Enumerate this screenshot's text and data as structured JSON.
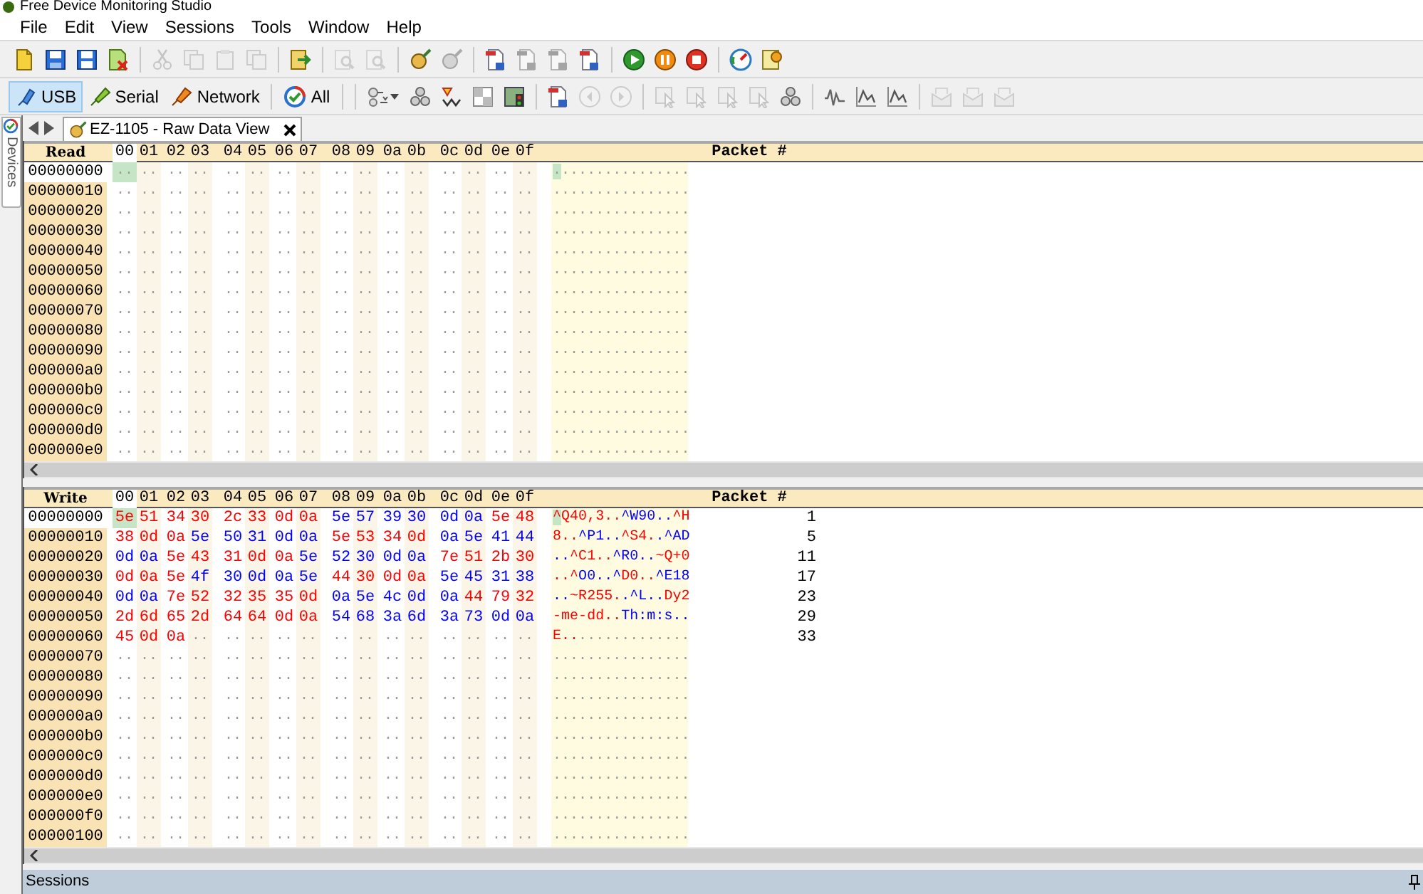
{
  "window": {
    "title": "Free Device Monitoring Studio"
  },
  "menu": [
    "File",
    "Edit",
    "View",
    "Sessions",
    "Tools",
    "Window",
    "Help"
  ],
  "toolbar": [
    {
      "kind": "new",
      "disabled": false
    },
    {
      "kind": "save",
      "disabled": false
    },
    {
      "kind": "saveas",
      "disabled": false
    },
    {
      "kind": "closedoc",
      "disabled": false
    },
    {
      "kind": "sep"
    },
    {
      "kind": "cut",
      "disabled": true
    },
    {
      "kind": "copy",
      "disabled": true
    },
    {
      "kind": "paste",
      "disabled": true
    },
    {
      "kind": "copy",
      "disabled": true
    },
    {
      "kind": "sep"
    },
    {
      "kind": "export",
      "disabled": false
    },
    {
      "kind": "sep"
    },
    {
      "kind": "find",
      "disabled": true
    },
    {
      "kind": "find",
      "disabled": true
    },
    {
      "kind": "sep"
    },
    {
      "kind": "brush",
      "disabled": false
    },
    {
      "kind": "brush",
      "disabled": true
    },
    {
      "kind": "sep"
    },
    {
      "kind": "page",
      "disabled": false
    },
    {
      "kind": "page",
      "disabled": true
    },
    {
      "kind": "page",
      "disabled": true
    },
    {
      "kind": "page",
      "disabled": false
    },
    {
      "kind": "sep"
    },
    {
      "kind": "play",
      "disabled": false
    },
    {
      "kind": "pause",
      "disabled": false
    },
    {
      "kind": "stop",
      "disabled": false
    },
    {
      "kind": "sep"
    },
    {
      "kind": "gauge",
      "disabled": false
    },
    {
      "kind": "gear",
      "disabled": false
    }
  ],
  "filters": [
    {
      "label": "USB",
      "kind": "usb",
      "selected": true
    },
    {
      "label": "Serial",
      "kind": "serial",
      "selected": false
    },
    {
      "label": "Network",
      "kind": "network",
      "selected": false
    },
    {
      "label": "All",
      "kind": "all",
      "selected": false
    }
  ],
  "toolbar2": [
    {
      "kind": "filter",
      "disabled": false
    },
    {
      "kind": "nodes",
      "disabled": false
    },
    {
      "kind": "sort",
      "disabled": false
    },
    {
      "kind": "grid",
      "disabled": false
    },
    {
      "kind": "traffic",
      "disabled": false
    },
    {
      "kind": "sep"
    },
    {
      "kind": "page",
      "disabled": false
    },
    {
      "kind": "prev",
      "disabled": true
    },
    {
      "kind": "next",
      "disabled": true
    },
    {
      "kind": "sep"
    },
    {
      "kind": "cursor",
      "disabled": true
    },
    {
      "kind": "cursor",
      "disabled": true
    },
    {
      "kind": "cursor",
      "disabled": true
    },
    {
      "kind": "cursor",
      "disabled": true
    },
    {
      "kind": "nodes",
      "disabled": false
    },
    {
      "kind": "sep"
    },
    {
      "kind": "wave",
      "disabled": false
    },
    {
      "kind": "chart",
      "disabled": false
    },
    {
      "kind": "chart",
      "disabled": false
    },
    {
      "kind": "sep"
    },
    {
      "kind": "mail",
      "disabled": true
    },
    {
      "kind": "mail",
      "disabled": true
    },
    {
      "kind": "mail",
      "disabled": true
    }
  ],
  "side_panel": {
    "label": "Devices"
  },
  "tab": {
    "label": "EZ-1105 - Raw Data View",
    "selected": true
  },
  "read_pane": {
    "title": "Read",
    "packet_header": "Packet #",
    "columns": [
      {
        "label": "00",
        "selected": true
      },
      {
        "label": "01",
        "selected": false
      },
      {
        "label": "02",
        "selected": false
      },
      {
        "label": "03",
        "selected": false
      },
      {
        "label": "04",
        "selected": false
      },
      {
        "label": "05",
        "selected": false
      },
      {
        "label": "06",
        "selected": false
      },
      {
        "label": "07",
        "selected": false
      },
      {
        "label": "08",
        "selected": false
      },
      {
        "label": "09",
        "selected": false
      },
      {
        "label": "0a",
        "selected": false
      },
      {
        "label": "0b",
        "selected": false
      },
      {
        "label": "0c",
        "selected": false
      },
      {
        "label": "0d",
        "selected": false
      },
      {
        "label": "0e",
        "selected": false
      },
      {
        "label": "0f",
        "selected": false
      }
    ],
    "rows": [
      {
        "address": "00000000",
        "selected": true,
        "bytes": [
          "..",
          "..",
          "..",
          "..",
          "..",
          "..",
          "..",
          "..",
          "..",
          "..",
          "..",
          "..",
          "..",
          "..",
          "..",
          ".."
        ],
        "ascii": "................"
      },
      {
        "address": "00000010",
        "selected": false,
        "bytes": [
          "..",
          "..",
          "..",
          "..",
          "..",
          "..",
          "..",
          "..",
          "..",
          "..",
          "..",
          "..",
          "..",
          "..",
          "..",
          ".."
        ],
        "ascii": "................"
      },
      {
        "address": "00000020",
        "selected": false,
        "bytes": [
          "..",
          "..",
          "..",
          "..",
          "..",
          "..",
          "..",
          "..",
          "..",
          "..",
          "..",
          "..",
          "..",
          "..",
          "..",
          ".."
        ],
        "ascii": "................"
      },
      {
        "address": "00000030",
        "selected": false,
        "bytes": [
          "..",
          "..",
          "..",
          "..",
          "..",
          "..",
          "..",
          "..",
          "..",
          "..",
          "..",
          "..",
          "..",
          "..",
          "..",
          ".."
        ],
        "ascii": "................"
      },
      {
        "address": "00000040",
        "selected": false,
        "bytes": [
          "..",
          "..",
          "..",
          "..",
          "..",
          "..",
          "..",
          "..",
          "..",
          "..",
          "..",
          "..",
          "..",
          "..",
          "..",
          ".."
        ],
        "ascii": "................"
      },
      {
        "address": "00000050",
        "selected": false,
        "bytes": [
          "..",
          "..",
          "..",
          "..",
          "..",
          "..",
          "..",
          "..",
          "..",
          "..",
          "..",
          "..",
          "..",
          "..",
          "..",
          ".."
        ],
        "ascii": "................"
      },
      {
        "address": "00000060",
        "selected": false,
        "bytes": [
          "..",
          "..",
          "..",
          "..",
          "..",
          "..",
          "..",
          "..",
          "..",
          "..",
          "..",
          "..",
          "..",
          "..",
          "..",
          ".."
        ],
        "ascii": "................"
      },
      {
        "address": "00000070",
        "selected": false,
        "bytes": [
          "..",
          "..",
          "..",
          "..",
          "..",
          "..",
          "..",
          "..",
          "..",
          "..",
          "..",
          "..",
          "..",
          "..",
          "..",
          ".."
        ],
        "ascii": "................"
      },
      {
        "address": "00000080",
        "selected": false,
        "bytes": [
          "..",
          "..",
          "..",
          "..",
          "..",
          "..",
          "..",
          "..",
          "..",
          "..",
          "..",
          "..",
          "..",
          "..",
          "..",
          ".."
        ],
        "ascii": "................"
      },
      {
        "address": "00000090",
        "selected": false,
        "bytes": [
          "..",
          "..",
          "..",
          "..",
          "..",
          "..",
          "..",
          "..",
          "..",
          "..",
          "..",
          "..",
          "..",
          "..",
          "..",
          ".."
        ],
        "ascii": "................"
      },
      {
        "address": "000000a0",
        "selected": false,
        "bytes": [
          "..",
          "..",
          "..",
          "..",
          "..",
          "..",
          "..",
          "..",
          "..",
          "..",
          "..",
          "..",
          "..",
          "..",
          "..",
          ".."
        ],
        "ascii": "................"
      },
      {
        "address": "000000b0",
        "selected": false,
        "bytes": [
          "..",
          "..",
          "..",
          "..",
          "..",
          "..",
          "..",
          "..",
          "..",
          "..",
          "..",
          "..",
          "..",
          "..",
          "..",
          ".."
        ],
        "ascii": "................"
      },
      {
        "address": "000000c0",
        "selected": false,
        "bytes": [
          "..",
          "..",
          "..",
          "..",
          "..",
          "..",
          "..",
          "..",
          "..",
          "..",
          "..",
          "..",
          "..",
          "..",
          "..",
          ".."
        ],
        "ascii": "................"
      },
      {
        "address": "000000d0",
        "selected": false,
        "bytes": [
          "..",
          "..",
          "..",
          "..",
          "..",
          "..",
          "..",
          "..",
          "..",
          "..",
          "..",
          "..",
          "..",
          "..",
          "..",
          ".."
        ],
        "ascii": "................"
      },
      {
        "address": "000000e0",
        "selected": false,
        "bytes": [
          "..",
          "..",
          "..",
          "..",
          "..",
          "..",
          "..",
          "..",
          "..",
          "..",
          "..",
          "..",
          "..",
          "..",
          "..",
          ".."
        ],
        "ascii": "................"
      }
    ]
  },
  "write_pane": {
    "title": "Write",
    "packet_header": "Packet #",
    "columns": [
      {
        "label": "00",
        "selected": true
      },
      {
        "label": "01",
        "selected": false
      },
      {
        "label": "02",
        "selected": false
      },
      {
        "label": "03",
        "selected": false
      },
      {
        "label": "04",
        "selected": false
      },
      {
        "label": "05",
        "selected": false
      },
      {
        "label": "06",
        "selected": false
      },
      {
        "label": "07",
        "selected": false
      },
      {
        "label": "08",
        "selected": false
      },
      {
        "label": "09",
        "selected": false
      },
      {
        "label": "0a",
        "selected": false
      },
      {
        "label": "0b",
        "selected": false
      },
      {
        "label": "0c",
        "selected": false
      },
      {
        "label": "0d",
        "selected": false
      },
      {
        "label": "0e",
        "selected": false
      },
      {
        "label": "0f",
        "selected": false
      }
    ],
    "rows": [
      {
        "address": "00000000",
        "selected": true,
        "packet": "1",
        "bytes": [
          {
            "text": "5e",
            "color": "#ff0000"
          },
          {
            "text": "51",
            "color": "#ff0000"
          },
          {
            "text": "34",
            "color": "#ff0000"
          },
          {
            "text": "30",
            "color": "#ff0000"
          },
          {
            "text": "2c",
            "color": "#ff0000"
          },
          {
            "text": "33",
            "color": "#ff0000"
          },
          {
            "text": "0d",
            "color": "#ff0000"
          },
          {
            "text": "0a",
            "color": "#ff0000"
          },
          {
            "text": "5e",
            "color": "#0000ff"
          },
          {
            "text": "57",
            "color": "#0000ff"
          },
          {
            "text": "39",
            "color": "#0000ff"
          },
          {
            "text": "30",
            "color": "#0000ff"
          },
          {
            "text": "0d",
            "color": "#0000ff"
          },
          {
            "text": "0a",
            "color": "#0000ff"
          },
          {
            "text": "5e",
            "color": "#ff0000"
          },
          {
            "text": "48",
            "color": "#ff0000"
          }
        ],
        "ascii": "^Q40,3..^W90..^H"
      },
      {
        "address": "00000010",
        "selected": false,
        "packet": "5",
        "bytes": [
          {
            "text": "38",
            "color": "#ff0000"
          },
          {
            "text": "0d",
            "color": "#ff0000"
          },
          {
            "text": "0a",
            "color": "#ff0000"
          },
          {
            "text": "5e",
            "color": "#0000ff"
          },
          {
            "text": "50",
            "color": "#0000ff"
          },
          {
            "text": "31",
            "color": "#0000ff"
          },
          {
            "text": "0d",
            "color": "#0000ff"
          },
          {
            "text": "0a",
            "color": "#0000ff"
          },
          {
            "text": "5e",
            "color": "#ff0000"
          },
          {
            "text": "53",
            "color": "#ff0000"
          },
          {
            "text": "34",
            "color": "#ff0000"
          },
          {
            "text": "0d",
            "color": "#ff0000"
          },
          {
            "text": "0a",
            "color": "#0000ff"
          },
          {
            "text": "5e",
            "color": "#0000ff"
          },
          {
            "text": "41",
            "color": "#0000ff"
          },
          {
            "text": "44",
            "color": "#0000ff"
          }
        ],
        "ascii": "8..^P1..^S4..^AD"
      },
      {
        "address": "00000020",
        "selected": false,
        "packet": "11",
        "bytes": [
          {
            "text": "0d",
            "color": "#0000ff"
          },
          {
            "text": "0a",
            "color": "#0000ff"
          },
          {
            "text": "5e",
            "color": "#ff0000"
          },
          {
            "text": "43",
            "color": "#ff0000"
          },
          {
            "text": "31",
            "color": "#ff0000"
          },
          {
            "text": "0d",
            "color": "#ff0000"
          },
          {
            "text": "0a",
            "color": "#ff0000"
          },
          {
            "text": "5e",
            "color": "#0000ff"
          },
          {
            "text": "52",
            "color": "#0000ff"
          },
          {
            "text": "30",
            "color": "#0000ff"
          },
          {
            "text": "0d",
            "color": "#0000ff"
          },
          {
            "text": "0a",
            "color": "#0000ff"
          },
          {
            "text": "7e",
            "color": "#ff0000"
          },
          {
            "text": "51",
            "color": "#ff0000"
          },
          {
            "text": "2b",
            "color": "#ff0000"
          },
          {
            "text": "30",
            "color": "#ff0000"
          }
        ],
        "ascii": "..^C1..^R0..~Q+0"
      },
      {
        "address": "00000030",
        "selected": false,
        "packet": "17",
        "bytes": [
          {
            "text": "0d",
            "color": "#ff0000"
          },
          {
            "text": "0a",
            "color": "#ff0000"
          },
          {
            "text": "5e",
            "color": "#ff0000"
          },
          {
            "text": "4f",
            "color": "#0000ff"
          },
          {
            "text": "30",
            "color": "#0000ff"
          },
          {
            "text": "0d",
            "color": "#0000ff"
          },
          {
            "text": "0a",
            "color": "#0000ff"
          },
          {
            "text": "5e",
            "color": "#0000ff"
          },
          {
            "text": "44",
            "color": "#ff0000"
          },
          {
            "text": "30",
            "color": "#ff0000"
          },
          {
            "text": "0d",
            "color": "#ff0000"
          },
          {
            "text": "0a",
            "color": "#ff0000"
          },
          {
            "text": "5e",
            "color": "#0000ff"
          },
          {
            "text": "45",
            "color": "#0000ff"
          },
          {
            "text": "31",
            "color": "#0000ff"
          },
          {
            "text": "38",
            "color": "#0000ff"
          }
        ],
        "ascii": "..^O0..^D0..^E18"
      },
      {
        "address": "00000040",
        "selected": false,
        "packet": "23",
        "bytes": [
          {
            "text": "0d",
            "color": "#0000ff"
          },
          {
            "text": "0a",
            "color": "#0000ff"
          },
          {
            "text": "7e",
            "color": "#ff0000"
          },
          {
            "text": "52",
            "color": "#ff0000"
          },
          {
            "text": "32",
            "color": "#ff0000"
          },
          {
            "text": "35",
            "color": "#ff0000"
          },
          {
            "text": "35",
            "color": "#ff0000"
          },
          {
            "text": "0d",
            "color": "#ff0000"
          },
          {
            "text": "0a",
            "color": "#0000ff"
          },
          {
            "text": "5e",
            "color": "#0000ff"
          },
          {
            "text": "4c",
            "color": "#0000ff"
          },
          {
            "text": "0d",
            "color": "#0000ff"
          },
          {
            "text": "0a",
            "color": "#0000ff"
          },
          {
            "text": "44",
            "color": "#ff0000"
          },
          {
            "text": "79",
            "color": "#ff0000"
          },
          {
            "text": "32",
            "color": "#ff0000"
          }
        ],
        "ascii": "..~R255..^L..Dy2"
      },
      {
        "address": "00000050",
        "selected": false,
        "packet": "29",
        "bytes": [
          {
            "text": "2d",
            "color": "#ff0000"
          },
          {
            "text": "6d",
            "color": "#ff0000"
          },
          {
            "text": "65",
            "color": "#ff0000"
          },
          {
            "text": "2d",
            "color": "#ff0000"
          },
          {
            "text": "64",
            "color": "#ff0000"
          },
          {
            "text": "64",
            "color": "#ff0000"
          },
          {
            "text": "0d",
            "color": "#ff0000"
          },
          {
            "text": "0a",
            "color": "#ff0000"
          },
          {
            "text": "54",
            "color": "#0000ff"
          },
          {
            "text": "68",
            "color": "#0000ff"
          },
          {
            "text": "3a",
            "color": "#0000ff"
          },
          {
            "text": "6d",
            "color": "#0000ff"
          },
          {
            "text": "3a",
            "color": "#0000ff"
          },
          {
            "text": "73",
            "color": "#0000ff"
          },
          {
            "text": "0d",
            "color": "#0000ff"
          },
          {
            "text": "0a",
            "color": "#0000ff"
          }
        ],
        "ascii": "-me-dd..Th:m:s.."
      },
      {
        "address": "00000060",
        "selected": false,
        "packet": "33",
        "bytes": [
          {
            "text": "45",
            "color": "#ff0000"
          },
          {
            "text": "0d",
            "color": "#ff0000"
          },
          {
            "text": "0a",
            "color": "#ff0000"
          },
          "..",
          "..",
          "..",
          "..",
          "..",
          "..",
          "..",
          "..",
          "..",
          "..",
          "..",
          "..",
          ".."
        ],
        "ascii": "E..............."
      },
      {
        "address": "00000070",
        "selected": false,
        "bytes": [
          "..",
          "..",
          "..",
          "..",
          "..",
          "..",
          "..",
          "..",
          "..",
          "..",
          "..",
          "..",
          "..",
          "..",
          "..",
          ".."
        ],
        "ascii": "................"
      },
      {
        "address": "00000080",
        "selected": false,
        "bytes": [
          "..",
          "..",
          "..",
          "..",
          "..",
          "..",
          "..",
          "..",
          "..",
          "..",
          "..",
          "..",
          "..",
          "..",
          "..",
          ".."
        ],
        "ascii": "................"
      },
      {
        "address": "00000090",
        "selected": false,
        "bytes": [
          "..",
          "..",
          "..",
          "..",
          "..",
          "..",
          "..",
          "..",
          "..",
          "..",
          "..",
          "..",
          "..",
          "..",
          "..",
          ".."
        ],
        "ascii": "................"
      },
      {
        "address": "000000a0",
        "selected": false,
        "bytes": [
          "..",
          "..",
          "..",
          "..",
          "..",
          "..",
          "..",
          "..",
          "..",
          "..",
          "..",
          "..",
          "..",
          "..",
          "..",
          ".."
        ],
        "ascii": "................"
      },
      {
        "address": "000000b0",
        "selected": false,
        "bytes": [
          "..",
          "..",
          "..",
          "..",
          "..",
          "..",
          "..",
          "..",
          "..",
          "..",
          "..",
          "..",
          "..",
          "..",
          "..",
          ".."
        ],
        "ascii": "................"
      },
      {
        "address": "000000c0",
        "selected": false,
        "bytes": [
          "..",
          "..",
          "..",
          "..",
          "..",
          "..",
          "..",
          "..",
          "..",
          "..",
          "..",
          "..",
          "..",
          "..",
          "..",
          ".."
        ],
        "ascii": "................"
      },
      {
        "address": "000000d0",
        "selected": false,
        "bytes": [
          "..",
          "..",
          "..",
          "..",
          "..",
          "..",
          "..",
          "..",
          "..",
          "..",
          "..",
          "..",
          "..",
          "..",
          "..",
          ".."
        ],
        "ascii": "................"
      },
      {
        "address": "000000e0",
        "selected": false,
        "bytes": [
          "..",
          "..",
          "..",
          "..",
          "..",
          "..",
          "..",
          "..",
          "..",
          "..",
          "..",
          "..",
          "..",
          "..",
          "..",
          ".."
        ],
        "ascii": "................"
      },
      {
        "address": "000000f0",
        "selected": false,
        "bytes": [
          "..",
          "..",
          "..",
          "..",
          "..",
          "..",
          "..",
          "..",
          "..",
          "..",
          "..",
          "..",
          "..",
          "..",
          "..",
          ".."
        ],
        "ascii": "................"
      },
      {
        "address": "00000100",
        "selected": false,
        "bytes": [
          "..",
          "..",
          "..",
          "..",
          "..",
          "..",
          "..",
          "..",
          "..",
          "..",
          "..",
          "..",
          "..",
          "..",
          "..",
          ".."
        ],
        "ascii": "................"
      }
    ]
  },
  "status_panel": {
    "title": "Sessions"
  }
}
